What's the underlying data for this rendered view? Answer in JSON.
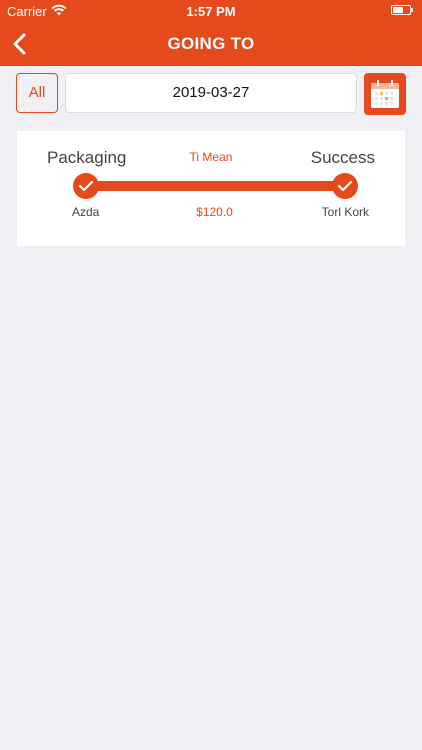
{
  "status_bar": {
    "carrier": "Carrier",
    "time": "1:57 PM"
  },
  "nav": {
    "title": "GOING TO",
    "back_icon": "chevron-left-icon"
  },
  "filter": {
    "all_label": "All",
    "date": "2019-03-27",
    "calendar_icon": "calendar-icon"
  },
  "route": {
    "from_stage": "Packaging",
    "to_stage": "Success",
    "middle_label": "Ti Mean",
    "from_place": "Azda",
    "price": "$120.0",
    "to_place": "Torl Kork"
  },
  "colors": {
    "accent": "#e44a1c",
    "background": "#efeff4"
  }
}
